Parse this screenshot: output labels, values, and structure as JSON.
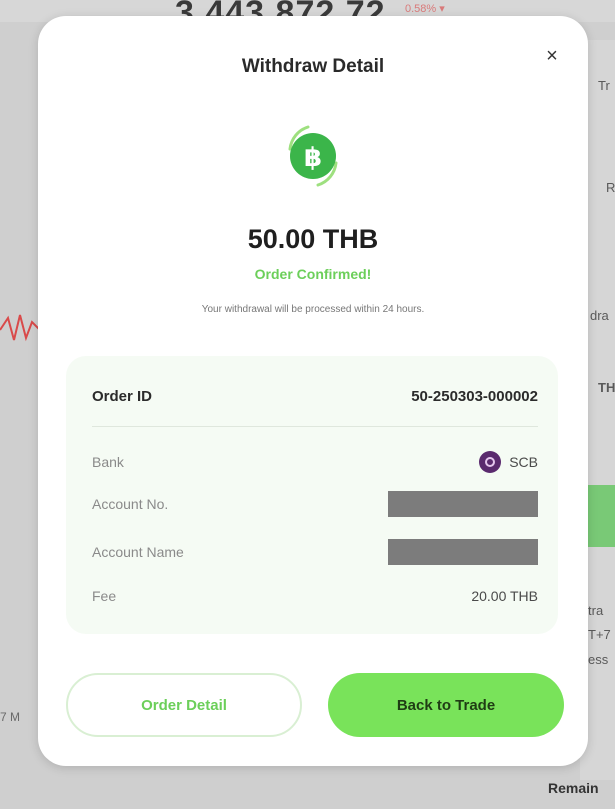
{
  "background": {
    "balance_partial": "3,443,872.72",
    "change": "0.58% ▾",
    "right_texts": [
      "Tr",
      "R",
      "dra",
      "TH",
      "tra",
      "T+7",
      "ess"
    ],
    "bottom_left": "7 M",
    "bottom_right": "Remain"
  },
  "modal": {
    "title": "Withdraw Detail",
    "close_symbol": "×",
    "coin_icon": "baht-coin-icon",
    "amount": "50.00 THB",
    "status": "Order Confirmed!",
    "note": "Your withdrawal will be processed within 24 hours.",
    "card": {
      "order_label": "Order ID",
      "order_value": "50-250303-000002",
      "rows": [
        {
          "label": "Bank",
          "value": "SCB"
        },
        {
          "label": "Account No.",
          "value": ""
        },
        {
          "label": "Account Name",
          "value": ""
        },
        {
          "label": "Fee",
          "value": "20.00 THB"
        }
      ]
    },
    "buttons": {
      "order_detail": "Order Detail",
      "back_to_trade": "Back to Trade"
    }
  },
  "colors": {
    "accent_green": "#79e35a",
    "status_green": "#6ccf5a",
    "coin_green": "#3bb54a",
    "bank_purple": "#5a2a6e"
  }
}
